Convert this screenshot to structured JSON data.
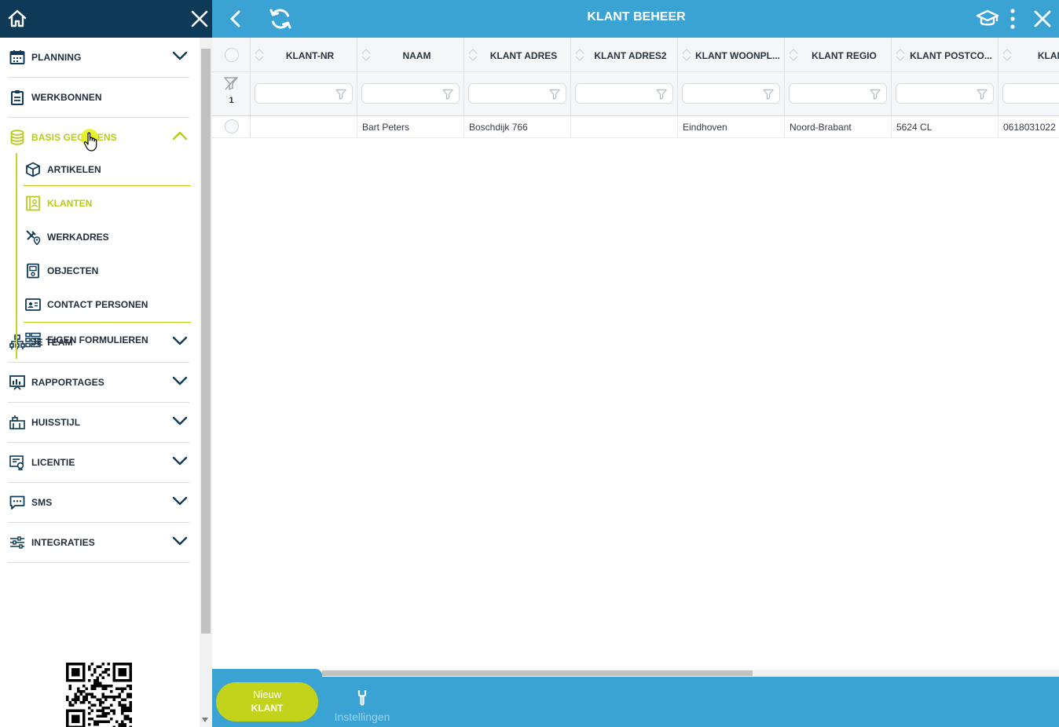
{
  "colors": {
    "sidebar_header": "#0f3a57",
    "topbar": "#3aa3d3",
    "accent_lime": "#b8cc18",
    "new_button": "#c3d21a"
  },
  "icons": {
    "home": "home-icon",
    "close": "close-icon",
    "back": "chevron-left-icon",
    "refresh": "refresh-icon",
    "help": "graduation-cap-icon",
    "more": "more-vertical-icon",
    "settings": "wrench-icon"
  },
  "topbar": {
    "title": "KLANT BEHEER"
  },
  "sidebar": {
    "sections": [
      {
        "label": "PLANNING",
        "icon": "calendar-icon"
      },
      {
        "label": "WERKBONNEN",
        "icon": "clipboard-icon"
      },
      {
        "label": "BASIS GEGEVENS",
        "icon": "database-icon",
        "expanded": true
      },
      {
        "label": "JE TEAM",
        "icon": "org-chart-icon"
      },
      {
        "label": "RAPPORTAGES",
        "icon": "presentation-icon"
      },
      {
        "label": "HUISSTIJL",
        "icon": "paint-roller-icon"
      },
      {
        "label": "LICENTIE",
        "icon": "certificate-icon"
      },
      {
        "label": "SMS",
        "icon": "chat-icon"
      },
      {
        "label": "INTEGRATIES",
        "icon": "sliders-icon"
      }
    ],
    "basis_items": [
      {
        "label": "ARTIKELEN",
        "icon": "box-icon"
      },
      {
        "label": "KLANTEN",
        "icon": "address-book-icon",
        "active": true
      },
      {
        "label": "WERKADRES",
        "icon": "tools-location-icon"
      },
      {
        "label": "OBJECTEN",
        "icon": "device-icon"
      },
      {
        "label": "CONTACT PERSONEN",
        "icon": "contact-card-icon"
      },
      {
        "label": "EIGEN FORMULIEREN",
        "icon": "form-list-icon"
      }
    ]
  },
  "grid": {
    "columns": [
      "KLANT-NR",
      "NAAM",
      "KLANT ADRES",
      "KLANT ADRES2",
      "KLANT WOONPL...",
      "KLANT REGIO",
      "KLANT POSTCO...",
      "KLANT T"
    ],
    "filter_count": "1",
    "rows": [
      [
        "",
        "Bart Peters",
        "Boschdijk 766",
        "",
        "Eindhoven",
        "Noord-Brabant",
        "5624 CL",
        "0618031022"
      ]
    ]
  },
  "bottombar": {
    "new_line1": "Nieuw",
    "new_line2": "KLANT",
    "settings_label": "Instellingen"
  }
}
